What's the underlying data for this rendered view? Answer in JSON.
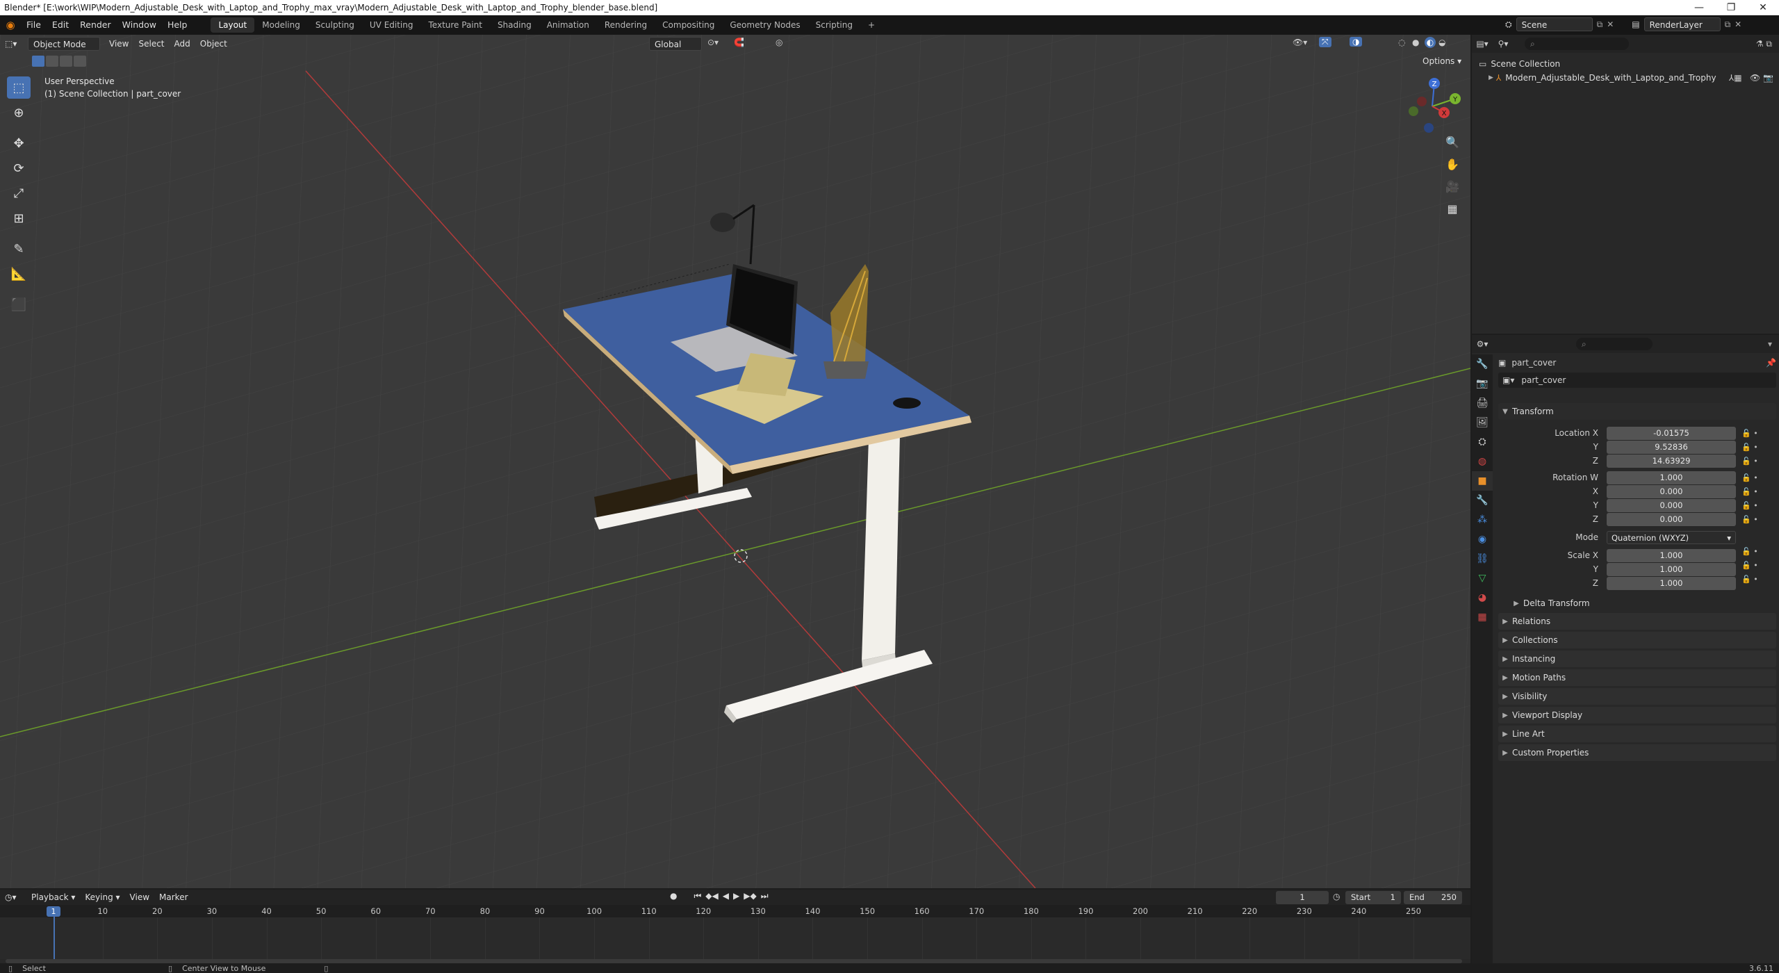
{
  "window": {
    "title": "Blender* [E:\\work\\WIP\\Modern_Adjustable_Desk_with_Laptop_and_Trophy_max_vray\\Modern_Adjustable_Desk_with_Laptop_and_Trophy_blender_base.blend]"
  },
  "menu": {
    "items": [
      "File",
      "Edit",
      "Render",
      "Window",
      "Help"
    ]
  },
  "workspaces": [
    "Layout",
    "Modeling",
    "Sculpting",
    "UV Editing",
    "Texture Paint",
    "Shading",
    "Animation",
    "Rendering",
    "Compositing",
    "Geometry Nodes",
    "Scripting"
  ],
  "scene": {
    "name": "Scene",
    "render_layer": "RenderLayer"
  },
  "viewport": {
    "mode": "Object Mode",
    "menus": [
      "View",
      "Select",
      "Add",
      "Object"
    ],
    "orientation": "Global",
    "options_label": "Options",
    "perspective": "User Perspective",
    "collection_info": "(1) Scene Collection | part_cover",
    "gizmo": {
      "z": "Z",
      "y": "Y",
      "x": "X"
    }
  },
  "outliner": {
    "root": "Scene Collection",
    "items": [
      "Modern_Adjustable_Desk_with_Laptop_and_Trophy"
    ]
  },
  "properties": {
    "object_name": "part_cover",
    "data_name": "part_cover",
    "transform_label": "Transform",
    "location_label": "Location X",
    "location": {
      "x": "-0.01575",
      "y": "9.52836",
      "z": "14.63929"
    },
    "rotation_label": "Rotation W",
    "rotation": {
      "w": "1.000",
      "x": "0.000",
      "y": "0.000",
      "z": "0.000"
    },
    "mode_label": "Mode",
    "mode_value": "Quaternion (WXYZ)",
    "scale_label": "Scale X",
    "scale": {
      "x": "1.000",
      "y": "1.000",
      "z": "1.000"
    },
    "axis_labels": {
      "x": "X",
      "y": "Y",
      "z": "Z"
    },
    "delta_transform": "Delta Transform",
    "sections": [
      "Relations",
      "Collections",
      "Instancing",
      "Motion Paths",
      "Visibility",
      "Viewport Display",
      "Line Art",
      "Custom Properties"
    ]
  },
  "timeline": {
    "menus": [
      "Playback",
      "Keying",
      "View",
      "Marker"
    ],
    "current_frame": "1",
    "start_label": "Start",
    "start": "1",
    "end_label": "End",
    "end": "250",
    "ticks": [
      "10",
      "20",
      "30",
      "40",
      "50",
      "60",
      "70",
      "80",
      "90",
      "100",
      "110",
      "120",
      "130",
      "140",
      "150",
      "160",
      "170",
      "180",
      "190",
      "200",
      "210",
      "220",
      "230",
      "240",
      "250"
    ]
  },
  "statusbar": {
    "select": "Select",
    "center_view": "Center View to Mouse",
    "version": "3.6.11"
  },
  "colors": {
    "accent": "#4772b3",
    "desk_top": "#3f5f9f",
    "x_axis": "#b23a3a",
    "y_axis": "#6a9a2a"
  }
}
